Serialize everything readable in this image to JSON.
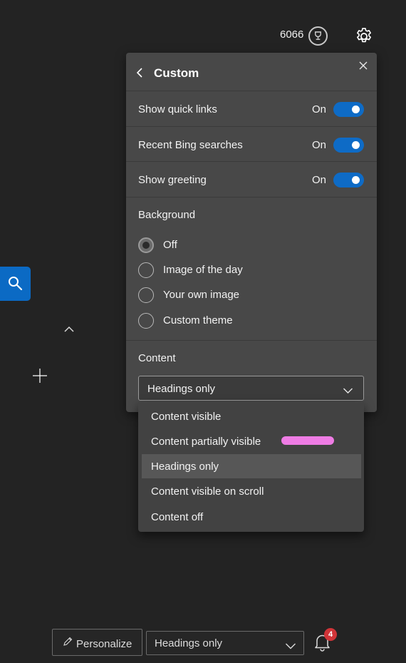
{
  "header": {
    "points": "6066",
    "reward_icon": "trophy-icon",
    "settings_icon": "gear-icon"
  },
  "panel": {
    "title": "Custom",
    "toggles": [
      {
        "label": "Show quick links",
        "state": "On"
      },
      {
        "label": "Recent Bing searches",
        "state": "On"
      },
      {
        "label": "Show greeting",
        "state": "On"
      }
    ],
    "background": {
      "label": "Background",
      "options": [
        "Off",
        "Image of the day",
        "Your own image",
        "Custom theme"
      ],
      "selected": "Off"
    },
    "content": {
      "label": "Content",
      "selected": "Headings only",
      "options": [
        "Content visible",
        "Content partially visible",
        "Headings only",
        "Content visible on scroll",
        "Content off"
      ]
    }
  },
  "bottom_bar": {
    "personalize_label": "Personalize",
    "layout_value": "Headings only",
    "notification_count": "4"
  },
  "colors": {
    "accent": "#0e6bc6",
    "panel_bg": "#484848",
    "page_bg": "#232323",
    "badge": "#d13438",
    "highlight_mark": "#ee7ce4"
  }
}
